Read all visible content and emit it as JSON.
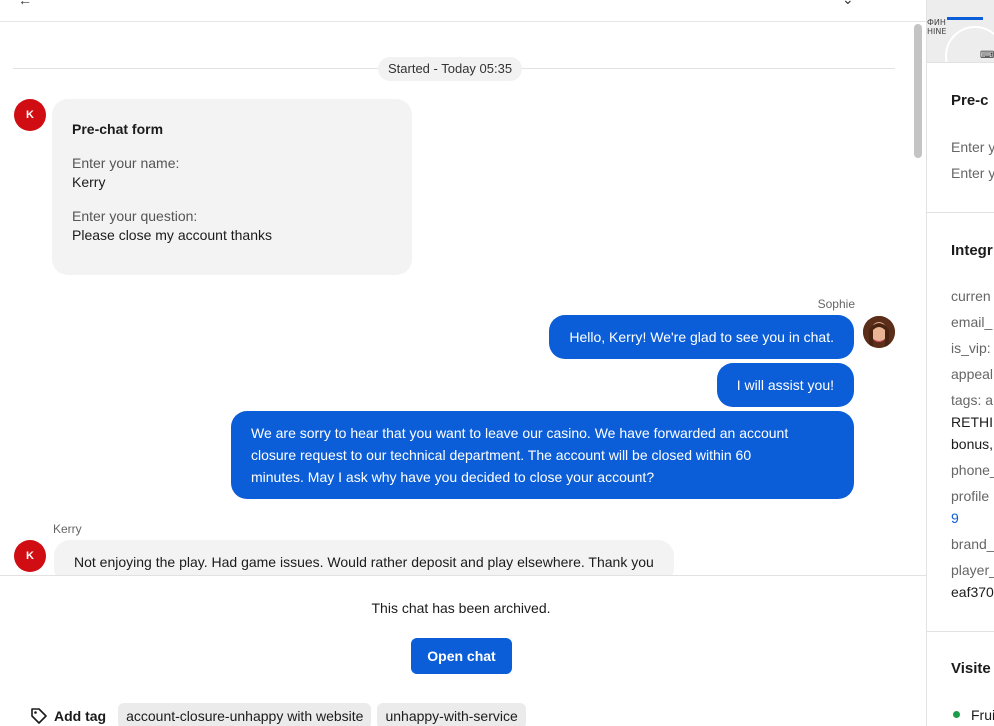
{
  "chat": {
    "started_label": "Started - Today 05:35",
    "prechat": {
      "title": "Pre-chat form",
      "name_label": "Enter your name:",
      "name_value": "Kerry",
      "question_label": "Enter your question:",
      "question_value": "Please close my account thanks"
    },
    "visitor": {
      "initial": "K",
      "name": "Kerry"
    },
    "agent": {
      "name": "Sophie"
    },
    "messages": {
      "agent_1": "Hello, Kerry! We're glad to see you in chat.",
      "agent_2": "I will assist you!",
      "agent_3_lines": [
        "We are sorry to hear that you want to leave our casino. We have forwarded an account",
        "closure request to our technical department. The account will be closed within 60",
        "minutes. May I ask why have you decided to close your account?"
      ],
      "visitor_1": "Not enjoying the play. Had game issues. Would rather deposit and play elsewhere. Thank you"
    }
  },
  "footer": {
    "archived_text": "This chat has been archived.",
    "open_chat_label": "Open chat",
    "add_tag_label": "Add tag",
    "tags": [
      "account-closure-unhappy with website",
      "unhappy-with-service"
    ]
  },
  "right_panel": {
    "map_text": [
      "ФИН",
      "HINE"
    ],
    "prechat_title": "Pre-c",
    "prechat_lines": [
      "Enter y",
      "Enter y"
    ],
    "integrations_title": "Integr",
    "integration_lines": [
      "curren",
      "email_",
      "is_vip:",
      "appeal",
      "tags: a",
      "RETHI",
      "bonus,",
      "phone_",
      "profile",
      "9",
      "brand_",
      "player_",
      "eaf370"
    ],
    "visitor_title": "Visite",
    "visitor_line": "Frui"
  },
  "colors": {
    "accent": "#0b5ed7",
    "visitor_avatar": "#d00d12",
    "bubble_gray": "#f3f3f3",
    "online_dot": "#1a9d4b"
  }
}
